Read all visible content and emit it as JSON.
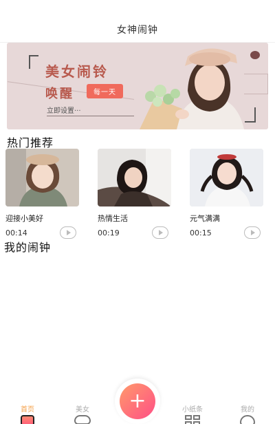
{
  "header": {
    "title": "女神闹钟"
  },
  "banner": {
    "headline": "美女闹铃",
    "subline": "唤醒",
    "badge": "每一天",
    "cta": "立即设置···"
  },
  "sections": {
    "hot_title": "热门推荐",
    "mine_title": "我的闹钟"
  },
  "cards": [
    {
      "name": "迎接小美好",
      "duration": "00:14",
      "icon": "play-icon"
    },
    {
      "name": "热情生活",
      "duration": "00:19",
      "icon": "play-icon"
    },
    {
      "name": "元气满满",
      "duration": "00:15",
      "icon": "play-icon"
    }
  ],
  "tabbar": {
    "items": [
      {
        "label": "首页",
        "icon": "clock-icon",
        "active": true
      },
      {
        "label": "美女",
        "icon": "heart-icon",
        "active": false
      },
      {
        "label": "小纸条",
        "icon": "grid-icon",
        "active": false
      },
      {
        "label": "我的",
        "icon": "face-icon",
        "active": false
      }
    ],
    "fab_symbol": "+"
  },
  "colors": {
    "accent": "#f4a04a",
    "fab_start": "#ff9a6b",
    "fab_end": "#ff4f86",
    "banner_bg": "#e7d8d8",
    "banner_text": "#b85a4e",
    "badge_bg": "#f06a5c"
  }
}
